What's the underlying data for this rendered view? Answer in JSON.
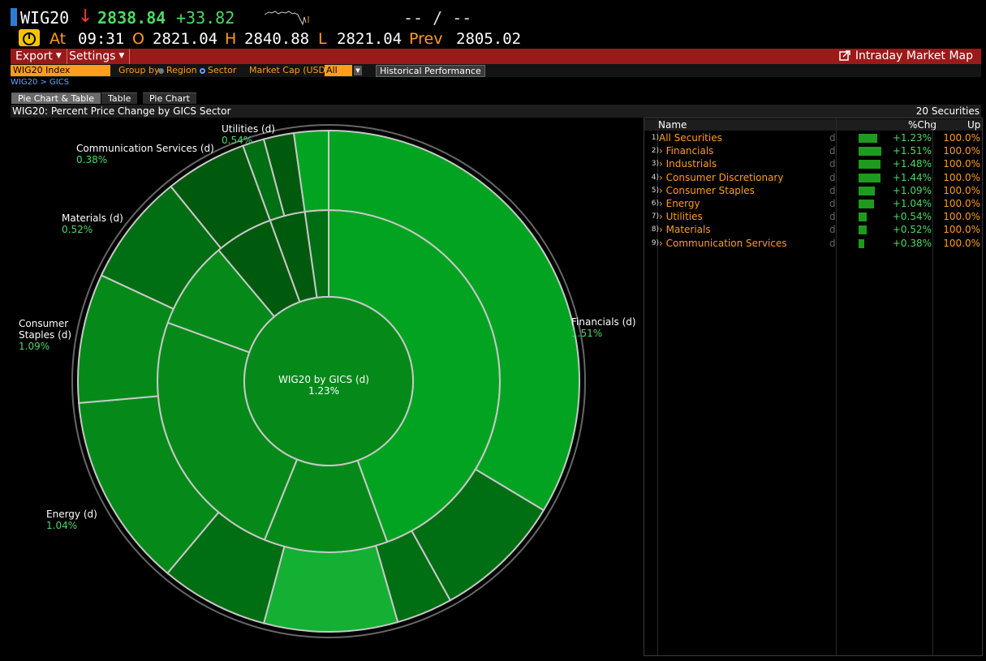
{
  "ticker": {
    "symbol": "WIG20",
    "arrow": "↓",
    "last": "2838.84",
    "change": "+33.82",
    "bid_ask": "-- / --",
    "at_label": "At",
    "time": "09:31",
    "open_label": "O",
    "open": "2821.04",
    "high_label": "H",
    "high": "2840.88",
    "low_label": "L",
    "low": "2821.04",
    "prev_label": "Prev",
    "prev": "2805.02"
  },
  "toolbar": {
    "export_label": "Export",
    "settings_label": "Settings",
    "market_map_label": "Intraday Market Map"
  },
  "options": {
    "security": "WIG20 Index",
    "group_by_label": "Group by",
    "region_label": "Region",
    "sector_label": "Sector",
    "market_cap_label": "Market Cap (USD)",
    "market_cap_value": "All",
    "historical_button": "Historical Performance"
  },
  "breadcrumb": "WIG20 > GICS",
  "tabs": [
    "Pie Chart & Table",
    "Table",
    "Pie Chart"
  ],
  "panel": {
    "title": "WIG20: Percent Price Change by GICS Sector",
    "count": "20 Securities"
  },
  "chart_data": {
    "type": "pie",
    "center_label": "WIG20 by GICS (d)",
    "center_value": "1.23%",
    "sectors": [
      {
        "name": "Financials (d)",
        "pct": "1.51%"
      },
      {
        "name": "Energy (d)",
        "pct": "1.04%"
      },
      {
        "name": "Consumer Staples (d)",
        "pct": "1.09%"
      },
      {
        "name": "Materials (d)",
        "pct": "0.52%"
      },
      {
        "name": "Communication Services (d)",
        "pct": "0.38%"
      },
      {
        "name": "Utilities (d)",
        "pct": "0.54%"
      }
    ],
    "colors": {
      "light": "#13b033",
      "mid": "#03a322",
      "dark": "#058a1a",
      "darker": "#006e12",
      "darkest": "#005a0e",
      "border": "#c8c8c8"
    }
  },
  "table": {
    "headers": {
      "name": "Name",
      "chg": "%Chg",
      "up": "Up"
    },
    "rows": [
      {
        "num": "1)",
        "name": "All Securities",
        "d": "d",
        "bar": 1.23,
        "chg": "+1.23%",
        "up": "100.0%"
      },
      {
        "num": "2)",
        "name": "› Financials",
        "d": "d",
        "bar": 1.51,
        "chg": "+1.51%",
        "up": "100.0%"
      },
      {
        "num": "3)",
        "name": "› Industrials",
        "d": "d",
        "bar": 1.48,
        "chg": "+1.48%",
        "up": "100.0%"
      },
      {
        "num": "4)",
        "name": "› Consumer Discretionary",
        "d": "d",
        "bar": 1.44,
        "chg": "+1.44%",
        "up": "100.0%"
      },
      {
        "num": "5)",
        "name": "› Consumer Staples",
        "d": "d",
        "bar": 1.09,
        "chg": "+1.09%",
        "up": "100.0%"
      },
      {
        "num": "6)",
        "name": "› Energy",
        "d": "d",
        "bar": 1.04,
        "chg": "+1.04%",
        "up": "100.0%"
      },
      {
        "num": "7)",
        "name": "› Utilities",
        "d": "d",
        "bar": 0.54,
        "chg": "+0.54%",
        "up": "100.0%"
      },
      {
        "num": "8)",
        "name": "› Materials",
        "d": "d",
        "bar": 0.52,
        "chg": "+0.52%",
        "up": "100.0%"
      },
      {
        "num": "9)",
        "name": "› Communication Services",
        "d": "d",
        "bar": 0.38,
        "chg": "+0.38%",
        "up": "100.0%"
      }
    ]
  }
}
